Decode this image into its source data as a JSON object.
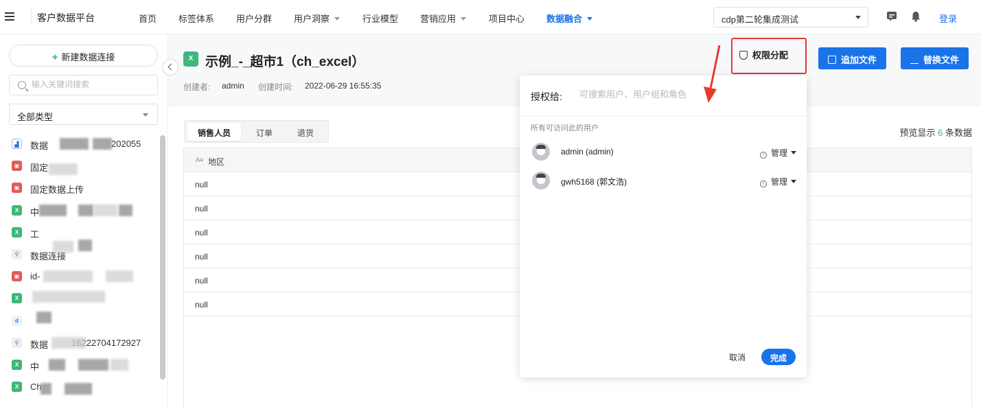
{
  "app": {
    "title": "客户数据平台"
  },
  "nav": {
    "items": [
      {
        "label": "首页",
        "dropdown": false,
        "active": false
      },
      {
        "label": "标签体系",
        "dropdown": false,
        "active": false
      },
      {
        "label": "用户分群",
        "dropdown": false,
        "active": false
      },
      {
        "label": "用户洞察",
        "dropdown": true,
        "active": false
      },
      {
        "label": "行业模型",
        "dropdown": false,
        "active": false
      },
      {
        "label": "营销应用",
        "dropdown": true,
        "active": false
      },
      {
        "label": "项目中心",
        "dropdown": false,
        "active": false
      },
      {
        "label": "数据融合",
        "dropdown": true,
        "active": true
      }
    ],
    "project": "cdp第二轮集成测试",
    "login": "登录"
  },
  "sidebar": {
    "new_connection": "新建数据连接",
    "search_placeholder": "输入关键词搜索",
    "type_filter": "全部类型",
    "items": [
      {
        "icon": "chart-source-icon",
        "label": "数据",
        "suffix": "202055"
      },
      {
        "icon": "db-red-icon",
        "label": "固定",
        "suffix": ""
      },
      {
        "icon": "db-red-icon",
        "label": "固定数据上传",
        "suffix": ""
      },
      {
        "icon": "excel-icon",
        "label": "中",
        "suffix": ""
      },
      {
        "icon": "excel-icon",
        "label": "工",
        "suffix": ""
      },
      {
        "icon": "api-icon",
        "label": "数据连接",
        "suffix": ""
      },
      {
        "icon": "db-red-icon",
        "label": "id-",
        "suffix": ""
      },
      {
        "icon": "excel-icon",
        "label": "",
        "suffix": ""
      },
      {
        "icon": "blue-ds-icon",
        "label": "",
        "suffix": ""
      },
      {
        "icon": "api-icon",
        "label": "数据",
        "suffix": "16222704172927"
      },
      {
        "icon": "excel-icon",
        "label": "中",
        "suffix": ""
      },
      {
        "icon": "excel-icon",
        "label": "Ch",
        "suffix": ""
      }
    ]
  },
  "dataset": {
    "title": "示例_-_超市1（ch_excel）",
    "creator_label": "创建者:",
    "creator": "admin",
    "created_label": "创建时间:",
    "created_at": "2022-06-29 16:55:35",
    "buttons": {
      "permission": "权限分配",
      "append": "追加文件",
      "replace": "替换文件"
    },
    "tabs": [
      "销售人员",
      "订单",
      "退货"
    ],
    "preview_prefix": "预览显示",
    "preview_count": "6",
    "preview_suffix": "条数据",
    "column": {
      "type": "A≡",
      "name": "地区"
    },
    "rows": [
      "null",
      "null",
      "null",
      "null",
      "null",
      "null"
    ]
  },
  "permission_popup": {
    "grant_label": "授权给:",
    "search_placeholder": "可搜索用户、用户组和角色",
    "section_label": "所有可访问此的用户",
    "users": [
      {
        "name": "admin (admin)",
        "role": "管理"
      },
      {
        "name": "gwh5168 (郭文浩)",
        "role": "管理"
      }
    ],
    "cancel": "取消",
    "done": "完成"
  },
  "colors": {
    "primary": "#1a73e8",
    "highlight_border": "#e33333",
    "excel": "#3db77a",
    "accent_count": "#28b5a8"
  }
}
